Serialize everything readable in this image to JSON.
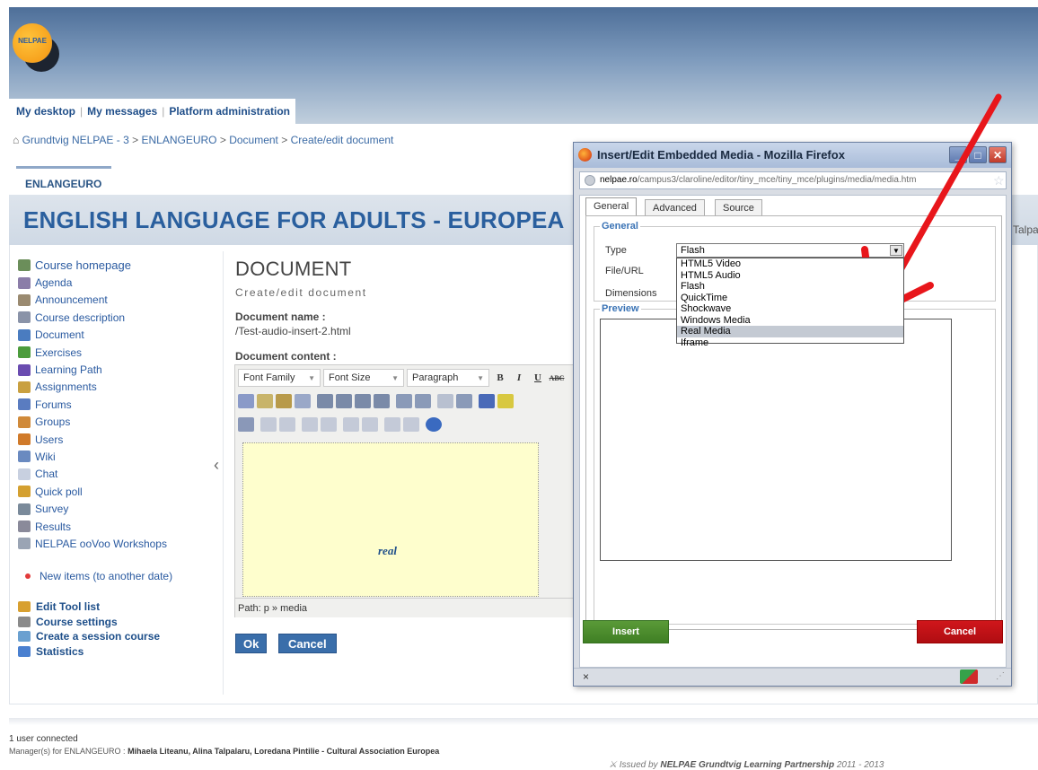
{
  "brand": {
    "logo_text": "NELPAE"
  },
  "top_nav": {
    "items": [
      "My desktop",
      "My messages",
      "Platform administration"
    ],
    "separator": "|"
  },
  "breadcrumb": {
    "home_icon": "⌂",
    "items": [
      "Grundtvig NELPAE - 3",
      "ENLANGEURO",
      "Document",
      "Create/edit document"
    ],
    "separator": ">"
  },
  "course": {
    "tab_label": "ENLANGEURO",
    "title": "ENGLISH LANGUAGE FOR ADULTS - EUROPEA",
    "trailing_text": "Talpa"
  },
  "sidebar": {
    "tools": [
      {
        "label": "Course homepage",
        "icon": "home-icon",
        "color": "#6b8e5a"
      },
      {
        "label": "Agenda",
        "icon": "calendar-icon",
        "color": "#8b7da8"
      },
      {
        "label": "Announcement",
        "icon": "announcement-icon",
        "color": "#9a8a70"
      },
      {
        "label": "Course description",
        "icon": "description-icon",
        "color": "#8a93a8"
      },
      {
        "label": "Document",
        "icon": "folder-icon",
        "color": "#4a7cc0"
      },
      {
        "label": "Exercises",
        "icon": "checkmark-icon",
        "color": "#4c9c3c"
      },
      {
        "label": "Learning Path",
        "icon": "heart-path-icon",
        "color": "#6a4cb0"
      },
      {
        "label": "Assignments",
        "icon": "pencil-icon",
        "color": "#c9a040"
      },
      {
        "label": "Forums",
        "icon": "forum-icon",
        "color": "#5a7cc0"
      },
      {
        "label": "Groups",
        "icon": "group-icon",
        "color": "#d08a3a"
      },
      {
        "label": "Users",
        "icon": "user-icon",
        "color": "#d07a2a"
      },
      {
        "label": "Wiki",
        "icon": "wiki-icon",
        "color": "#6a8ac0"
      },
      {
        "label": "Chat",
        "icon": "chat-icon",
        "color": "#c8d0e0"
      },
      {
        "label": "Quick poll",
        "icon": "poll-icon",
        "color": "#d4a030"
      },
      {
        "label": "Survey",
        "icon": "survey-icon",
        "color": "#7a8a9a"
      },
      {
        "label": "Results",
        "icon": "percent-icon",
        "color": "#8a8a9a"
      },
      {
        "label": "NELPAE ooVoo Workshops",
        "icon": "link-icon",
        "color": "#9aa4b4"
      }
    ],
    "new_items": "New items (to another date)",
    "admin": [
      {
        "label": "Edit Tool list",
        "icon": "edit-pencil-icon",
        "color": "#d8a030"
      },
      {
        "label": "Course settings",
        "icon": "wrench-icon",
        "color": "#8a8a8a"
      },
      {
        "label": "Create a session course",
        "icon": "session-icon",
        "color": "#6aa0d0"
      },
      {
        "label": "Statistics",
        "icon": "bar-chart-icon",
        "color": "#4a80d0"
      }
    ]
  },
  "main": {
    "heading": "DOCUMENT",
    "subheading": "Create/edit document",
    "doc_name_label": "Document name :",
    "doc_name_value": "/Test-audio-insert-2.html",
    "doc_content_label": "Document content :",
    "toolbar": {
      "font_family": "Font Family",
      "font_size": "Font Size",
      "paragraph": "Paragraph",
      "bold": "B",
      "italic": "I",
      "underline": "U",
      "strike": "ABC"
    },
    "media_logo": "real",
    "path_text": "Path: p » media",
    "ok_label": "Ok",
    "cancel_label": "Cancel"
  },
  "popup": {
    "title": "Insert/Edit Embedded Media - Mozilla Firefox",
    "url_host": "nelpae.ro",
    "url_path": "/campus3/claroline/editor/tiny_mce/tiny_mce/plugins/media/media.htm",
    "tabs": [
      "General",
      "Advanced",
      "Source"
    ],
    "general_legend": "General",
    "type_label": "Type",
    "type_value": "Flash",
    "file_url_label": "File/URL",
    "dimensions_label": "Dimensions",
    "type_options": [
      "HTML5 Video",
      "HTML5 Audio",
      "Flash",
      "QuickTime",
      "Shockwave",
      "Windows Media",
      "Real Media",
      "Iframe"
    ],
    "highlighted_option": "Real Media",
    "preview_legend": "Preview",
    "insert_label": "Insert",
    "cancel_label": "Cancel",
    "status_close": "×"
  },
  "footer": {
    "users_connected": "1 user connected",
    "managers_prefix": "Manager(s) for ENLANGEURO :",
    "managers": "Mihaela Liteanu, Alina Talpalaru, Loredana Pintilie - Cultural Association Europea",
    "issued_prefix": "Issued by",
    "issued_org": "NELPAE Grundtvig Learning Partnership",
    "issued_years": "2011 - 2013"
  },
  "colors": {
    "link": "#2a5aa0",
    "title": "#2a5f9e",
    "insert_green": "#4a8a2c",
    "cancel_red": "#c0111a",
    "annotation_arrow": "#e8161b"
  }
}
